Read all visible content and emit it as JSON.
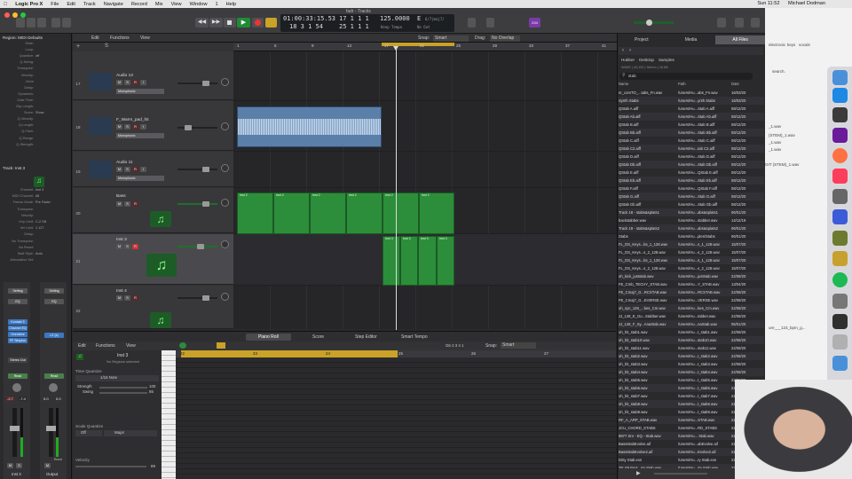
{
  "menubar": {
    "app": "Logic Pro X",
    "items": [
      "File",
      "Edit",
      "Track",
      "Navigate",
      "Record",
      "Mix",
      "View",
      "Window",
      "1",
      "Help"
    ],
    "clock": "Sun 11:52",
    "user": "Michael Dodman"
  },
  "window": {
    "title": "fadr - Tracks"
  },
  "lcd": {
    "time": "01:00:33:15.53",
    "time2": "18 3 1 54",
    "bar": "17 1 1 1",
    "bar2": "25 1 1 1",
    "tempo": "125.0000",
    "tempo_label": "Keep Tempo",
    "key": "E",
    "sig": "6/7|maj7/",
    "input": "No In",
    "output": "No Out",
    "counter": "234"
  },
  "inspector": {
    "region": "Region: MIDI Defaults",
    "rows": [
      [
        "Mute:",
        ""
      ],
      [
        "Loop:",
        ""
      ],
      [
        "Quantize:",
        "off"
      ],
      [
        "Q-Swing:",
        ""
      ],
      [
        "Transpose:",
        ""
      ],
      [
        "Velocity:",
        ""
      ],
      [
        "More",
        ""
      ],
      [
        "Delay:",
        ""
      ],
      [
        "Dynamics:",
        ""
      ],
      [
        "Gate Time:",
        ""
      ],
      [
        "Clip Length:",
        ""
      ],
      [
        "Score:",
        "Show"
      ],
      [
        "Q-Velocity:",
        ""
      ],
      [
        "Q-Length:",
        ""
      ],
      [
        "Q-Flam:",
        ""
      ],
      [
        "Q-Range:",
        ""
      ],
      [
        "Q-Strength:",
        ""
      ]
    ],
    "track": "Track: Inst 3",
    "track_rows": [
      [
        "Icon:",
        ""
      ],
      [
        "Channel:",
        "Inst 3"
      ],
      [
        "MIDI Channel:",
        "All"
      ],
      [
        "Freeze Mode:",
        "Pre Fader"
      ],
      [
        "Transpose:",
        ""
      ],
      [
        "Velocity:",
        ""
      ],
      [
        "Key Limit:",
        "C-2 G8"
      ],
      [
        "Vel Limit:",
        "1 127"
      ],
      [
        "Delay:",
        ""
      ],
      [
        "No Transpose:",
        ""
      ],
      [
        "No Reset:",
        ""
      ],
      [
        "Staff Style:",
        "Auto"
      ],
      [
        "Articulation Set:",
        ""
      ]
    ],
    "plugins": [
      "Kontakt 5",
      "Channel EQ",
      "Overdrive",
      "FF Simplon"
    ],
    "output_left": "Stereo Out",
    "read": "Read",
    "vals_left": [
      "-2.7",
      "-7.4"
    ],
    "vals_right": [
      "0.0",
      "0.0"
    ],
    "ch_left": "Inst 3",
    "ch_right": "Output",
    "bnce": "Bnce",
    "setting": "Setting",
    "grp": "EQ",
    "mute": "M",
    "solo": "S"
  },
  "arrange_toolbar": {
    "edit": "Edit",
    "functions": "Functions",
    "view": "View",
    "snap_label": "Snap:",
    "snap": "Smart",
    "drag_label": "Drag:",
    "drag": "No Overlap"
  },
  "ruler": [
    "1",
    "5",
    "9",
    "13",
    "17",
    "21",
    "25",
    "29",
    "33",
    "37",
    "41"
  ],
  "tracks": [
    {
      "num": "17",
      "name": "Audio 13",
      "plugin": "Monophonic",
      "type": "audio"
    },
    {
      "num": "18",
      "name": "F_Warm_pad_hit",
      "plugin": "Monophonic",
      "type": "audio"
    },
    {
      "num": "19",
      "name": "Audio 11",
      "plugin": "Monophonic",
      "type": "audio"
    },
    {
      "num": "20",
      "name": "Bass",
      "plugin": "",
      "type": "inst"
    },
    {
      "num": "21",
      "name": "Inst 3",
      "plugin": "",
      "type": "inst"
    },
    {
      "num": "22",
      "name": "Inst 4",
      "plugin": "",
      "type": "inst"
    }
  ],
  "region_label": "Inst 2",
  "region_label3": "Inst 3",
  "editor": {
    "tabs": [
      "Piano Roll",
      "Score",
      "Step Editor",
      "Smart Tempo"
    ],
    "edit": "Edit",
    "functions": "Functions",
    "view": "View",
    "region": "Inst 3",
    "region_sub": "No Regions selected",
    "tq": "Time Quantize",
    "note": "1/16 Note",
    "strength": "Strength",
    "strength_val": "100",
    "swing": "Swing",
    "swing_val": "85",
    "sq": "Scale Quantize",
    "off": "Off",
    "major": "Major",
    "velocity": "Velocity",
    "velocity_val": "89",
    "snap_label": "Snap:",
    "snap": "Smart",
    "pos": "G6 2 3 4 1",
    "ruler": [
      "22",
      "23",
      "24",
      "25",
      "26",
      "27"
    ]
  },
  "browser": {
    "tabs": [
      "Project",
      "Media",
      "All Files"
    ],
    "path": [
      "Hubber",
      "Desktop",
      "Samples"
    ],
    "info": "WAVE | 44,100 | Stereo | 16 Bit",
    "search": "stab",
    "cols": [
      "Name",
      "Path",
      "Date"
    ],
    "files": [
      [
        "nr_comTO_...tabs_Fn.wav",
        "/Users/Hu...abs_Fn.wav",
        "16/03/20"
      ],
      [
        "Synth Stabs",
        "/Users/Hu...ynth Stabs",
        "16/03/20"
      ],
      [
        "QStab A.aiff",
        "/Users/Hu...Stab A.aiff",
        "08/12/20"
      ],
      [
        "QStab Ab.aiff",
        "/Users/Hu...Stab Ab.aiff",
        "08/12/20"
      ],
      [
        "QStab B.aiff",
        "/Users/Hu...Stab B.aiff",
        "08/12/20"
      ],
      [
        "QStab Bb.aiff",
        "/Users/Hu...Stab Bb.aiff",
        "08/12/20"
      ],
      [
        "QStab C.aiff",
        "/Users/Hu...Stab C.aiff",
        "08/12/20"
      ],
      [
        "QStab C2.aiff",
        "/Users/Hu...tab C2.aiff",
        "08/12/20"
      ],
      [
        "QStab D.aiff",
        "/Users/Hu...Stab D.aiff",
        "08/12/20"
      ],
      [
        "QStab Db.aiff",
        "/Users/Hu...Stab Db.aiff",
        "08/12/20"
      ],
      [
        "QStab E.aiff",
        "/Users/Hu...QStab E.aiff",
        "08/12/20"
      ],
      [
        "QStab Eb.aiff",
        "/Users/Hu...Stab Eb.aiff",
        "08/12/20"
      ],
      [
        "QStab F.aiff",
        "/Users/Hu...QStab F.aiff",
        "08/12/20"
      ],
      [
        "QStab G.aiff",
        "/Users/Hu...Stab G.aiff",
        "08/12/20"
      ],
      [
        "QStab Gb.aiff",
        "/Users/Hu...Stab Gb.aiff",
        "08/12/20"
      ],
      [
        "Track 18 - stabs&splats1",
        "/Users/Hu...abs&splats1",
        "06/01/20"
      ],
      [
        "backstabber.wav",
        "/Users/Hu...stabber.wav",
        "14/12/19"
      ],
      [
        "Track 19 - stabs&splats2",
        "/Users/Hu...abs&splats2",
        "06/01/20"
      ],
      [
        "Stabs",
        "/Users/Hu...ples/Stabs",
        "06/01/20"
      ],
      [
        "FL_DS_Keys...bs_1_128.wav",
        "/Users/Hu...s_1_128.wav",
        "15/07/20"
      ],
      [
        "FL_DS_Keys...s_2_128.wav",
        "/Users/Hu...s_2_128.wav",
        "15/07/20"
      ],
      [
        "FL_DS_Keys...bs_1_128.wav",
        "/Users/Hu...s_1_128.wav",
        "15/07/20"
      ],
      [
        "FL_DS_Keys...s_2_128.wav",
        "/Users/Hu...s_2_128.wav",
        "15/07/20"
      ],
      [
        "oh_kick_juststab.wav",
        "/Users/Hu...juststab.wav",
        "22/08/20"
      ],
      [
        "FE_Cmb_TECHY_STAB.wav",
        "/Users/Hu...Y_STAB.wav",
        "13/04/20"
      ],
      [
        "FE_Cmaj7_G...RCSTAB.wav",
        "/Users/Hu...RCSTAB.wav",
        "22/08/20"
      ],
      [
        "FE_Cmaj7_G...EVERSE.wav",
        "/Users/Hu...VERSE.wav",
        "22/08/20"
      ],
      [
        "oh_syn_128_...bes_Cm.wav",
        "/Users/Hu...bes_Cm.wav",
        "22/08/20"
      ],
      [
        "JJ_128_E_Gu...Stabber.wav",
        "/Users/Hu...tabber.wav",
        "22/08/20"
      ],
      [
        "JJ_128_F_Sy...AnaStab.wav",
        "/Users/Hu...naStab.wav",
        "05/01/20"
      ],
      [
        "oh_hit_stab1.wav",
        "/Users/Hu...t_stab1.wav",
        "22/08/20"
      ],
      [
        "oh_hit_stab10.wav",
        "/Users/Hu...stab10.wav",
        "22/08/20"
      ],
      [
        "oh_hit_stab11.wav",
        "/Users/Hu...stab11.wav",
        "22/08/20"
      ],
      [
        "oh_hit_stab2.wav",
        "/Users/Hu...t_stab2.wav",
        "22/08/20"
      ],
      [
        "oh_hit_stab3.wav",
        "/Users/Hu...t_stab3.wav",
        "22/08/20"
      ],
      [
        "oh_hit_stab4.wav",
        "/Users/Hu...t_stab4.wav",
        "22/08/20"
      ],
      [
        "oh_hit_stab5.wav",
        "/Users/Hu...t_stab5.wav",
        "22/08/20"
      ],
      [
        "oh_hit_stab6.wav",
        "/Users/Hu...t_stab6.wav",
        "22/08/20"
      ],
      [
        "oh_hit_stab7.wav",
        "/Users/Hu...t_stab7.wav",
        "22/08/20"
      ],
      [
        "oh_hit_stab8.wav",
        "/Users/Hu...t_stab8.wav",
        "22/08/20"
      ],
      [
        "oh_hit_stab9.wav",
        "/Users/Hu...t_stab9.wav",
        "22/08/20"
      ],
      [
        "RF_A_ARP_STAB.wav",
        "/Users/Hu...STAB.wav",
        "22/08/20"
      ],
      [
        "JCU_CHORD_STABS",
        "/Users/Hu...RD_STABS",
        "22/08/20"
      ],
      [
        "9877 Snr - EQ - Stab.wav",
        "/Users/Hu... Stab.wav",
        "22/08/20"
      ],
      [
        "BassStabEvolve.aif",
        "/Users/Hu...abEvolve.aif",
        "22/08/20"
      ],
      [
        "BassStabEvolve2.aif",
        "/Users/Hu...Evolve2.aif",
        "22/08/20"
      ],
      [
        "Dirty Stab.exs",
        "/Users/Hu...ry Stab.exs",
        "22/08/20"
      ],
      [
        "T8: F# BAS...rty Stab.wav",
        "/Users/Hu...rty Stab.wav",
        "22/08/20"
      ]
    ]
  },
  "bg_window": {
    "lines": [
      "electronic",
      "keys",
      "vocals",
      "search.",
      "GIT (STEM)_1.wav",
      "_1.wav",
      "(STEM)_1.wav",
      "_1.wav",
      "_1.wav",
      "ure___123_bpm_g..."
    ]
  },
  "colors": {
    "region": "#2c8e3a",
    "cycle": "#c9a227",
    "accent": "#4a90d9"
  }
}
